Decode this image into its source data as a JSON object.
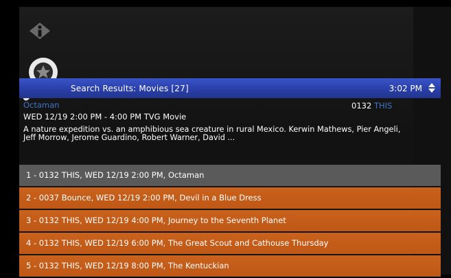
{
  "header": {
    "title": "Search Results: Movies [27]",
    "time": "3:02 PM"
  },
  "program": {
    "title": "Octaman",
    "channel_number": "0132",
    "channel_callsign": "THIS",
    "airtime": "WED 12/19 2:00 PM - 4:00 PM  TVG  Movie",
    "description": "A nature expedition vs. an amphibious sea creature in rural Mexico. Kerwin Mathews, Pier Angeli, Jeff Morrow, Jerome Guardino, Robert Warner, David ..."
  },
  "results": [
    {
      "label": "1 - 0132 THIS, WED 12/19 2:00 PM, Octaman"
    },
    {
      "label": "2 - 0037 Bounce, WED 12/19 2:00 PM, Devil in a Blue Dress"
    },
    {
      "label": "3 - 0132 THIS, WED 12/19 4:00 PM, Journey to the Seventh Planet"
    },
    {
      "label": "4 - 0132 THIS, WED 12/19 6:00 PM, The Great Scout and Cathouse Thursday"
    },
    {
      "label": "5 - 0132 THIS, WED 12/19 8:00 PM, The Kentuckian"
    }
  ],
  "colors": {
    "header_blue": "#2a3fa8",
    "title_blue": "#3e74c6",
    "row_orange": "#c9621c",
    "row_selected": "#5a5a5a"
  },
  "icons": {
    "info": "info-icon",
    "search": "search-icon",
    "updown": "up-down-arrow-icon"
  }
}
